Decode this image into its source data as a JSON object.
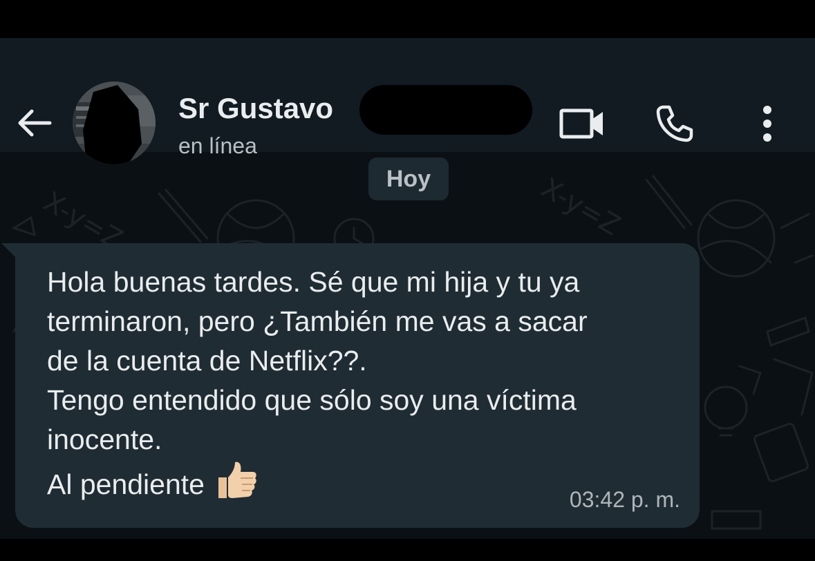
{
  "header": {
    "contact_name": "Sr Gustavo",
    "status": "en línea",
    "icons": {
      "back": "arrow-left-icon",
      "video": "video-camera-icon",
      "call": "phone-icon",
      "menu": "more-vertical-icon"
    }
  },
  "chat": {
    "date_divider": "Hoy",
    "messages": [
      {
        "direction": "incoming",
        "lines": [
          "Hola buenas tardes. Sé que mi hija y tu ya",
          "terminaron, pero ¿También me vas a sacar",
          "de la cuenta de Netflix??.",
          "Tengo entendido que sólo soy una víctima",
          "inocente.",
          "Al pendiente"
        ],
        "emoji": "thumbs-up-icon",
        "time": "03:42 p. m."
      }
    ]
  },
  "colors": {
    "background": "#0b1014",
    "header": "#111b21",
    "bubble_incoming": "#202c33",
    "text_primary": "#e9edef",
    "text_secondary": "#b9c1c6"
  }
}
